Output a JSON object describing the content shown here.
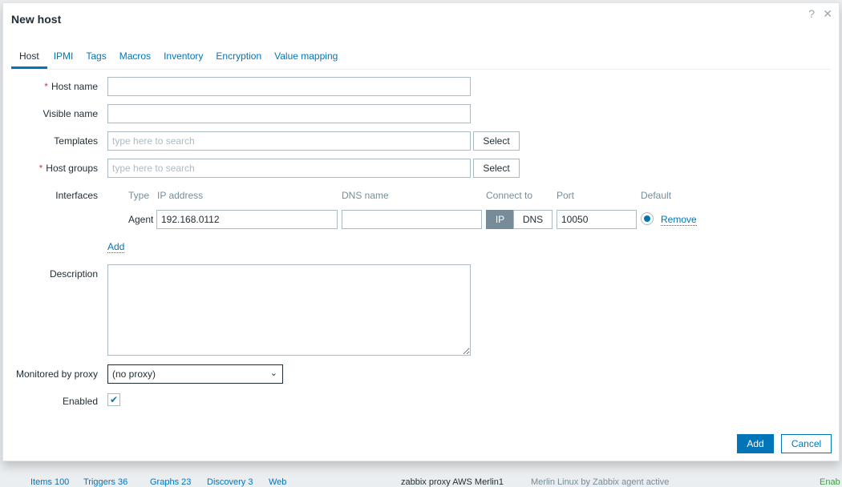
{
  "dialog": {
    "title": "New host",
    "help_icon": "?",
    "close_icon": "✕"
  },
  "tabs": [
    "Host",
    "IPMI",
    "Tags",
    "Macros",
    "Inventory",
    "Encryption",
    "Value mapping"
  ],
  "form": {
    "host_name_label": "Host name",
    "visible_name_label": "Visible name",
    "templates_label": "Templates",
    "templates_placeholder": "type here to search",
    "host_groups_label": "Host groups",
    "host_groups_placeholder": "type here to search",
    "select_label": "Select",
    "interfaces_label": "Interfaces",
    "interface_headers": {
      "type": "Type",
      "ip": "IP address",
      "dns": "DNS name",
      "connect": "Connect to",
      "port": "Port",
      "default": "Default"
    },
    "interface": {
      "type": "Agent",
      "ip": "192.168.0112",
      "dns": "",
      "connect_ip": "IP",
      "connect_dns": "DNS",
      "port": "10050",
      "remove": "Remove"
    },
    "add_interface": "Add",
    "description_label": "Description",
    "proxy_label": "Monitored by proxy",
    "proxy_value": "(no proxy)",
    "enabled_label": "Enabled",
    "required_mark": "*"
  },
  "footer": {
    "add": "Add",
    "cancel": "Cancel"
  },
  "background": {
    "items": "Items 100",
    "triggers": "Triggers 36",
    "graphs": "Graphs 23",
    "discovery": "Discovery 3",
    "web": "Web",
    "proxy": "zabbix proxy AWS Merlin1",
    "template": "Merlin Linux by Zabbix agent active",
    "status": "Enab"
  },
  "colors": {
    "accent": "#0275b8",
    "required": "#e33734"
  }
}
